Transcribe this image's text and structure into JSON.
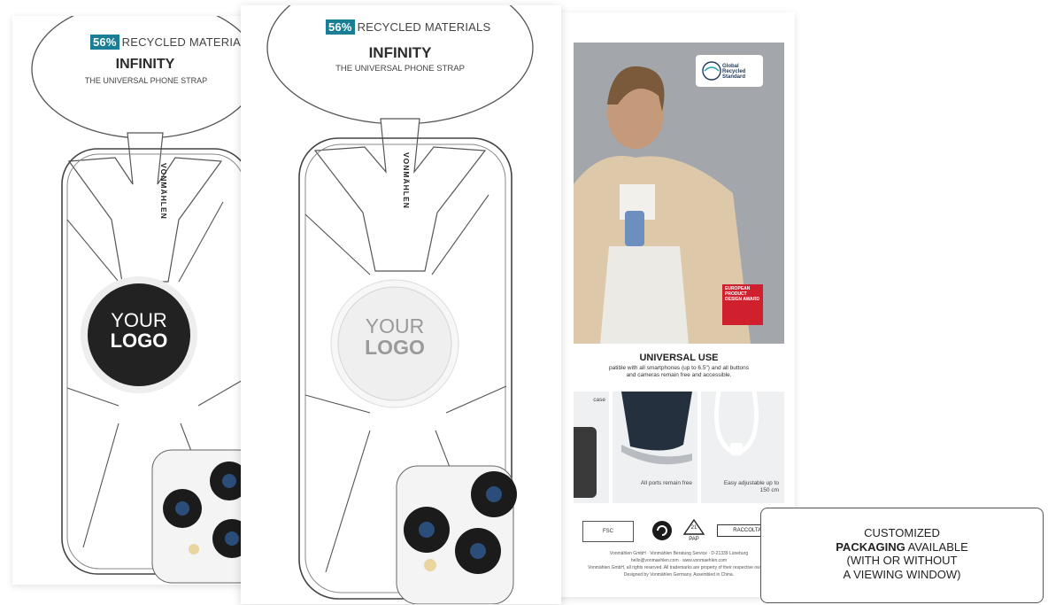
{
  "card_left": {
    "percent": "56%",
    "badge_text": "RECYCLED MATERIALS",
    "product_name": "INFINITY",
    "subtitle": "THE UNIVERSAL PHONE STRAP",
    "brand": "VONMÄHLEN",
    "logo_line1": "YOUR",
    "logo_line2": "LOGO"
  },
  "card_center": {
    "percent": "56%",
    "badge_text": "RECYCLED MATERIALS",
    "product_name": "INFINITY",
    "subtitle": "THE UNIVERSAL PHONE STRAP",
    "brand": "VONMÄHLEN",
    "logo_line1": "YOUR",
    "logo_line2": "LOGO"
  },
  "card_back": {
    "grs_label": "Global Recycled Standard",
    "award_label": "EUROPEAN PRODUCT DESIGN AWARD",
    "section_title": "UNIVERSAL USE",
    "section_text_1": "patible with all smartphones (up to 6.5\") and all buttons",
    "section_text_2": "and cameras remain free and accessible.",
    "thumb1_caption": "case",
    "thumb2_caption": "All ports remain free",
    "thumb3_caption": "Easy adjustable up to 150 cm",
    "fsc_label": "FSC",
    "recycle_code": "21",
    "recycle_label": "PAP",
    "raccolta_label": "RACCOLTA CA",
    "footer_line_1": "Vonmählen GmbH · Vonmählen Beratung Service · D-21339 Lüneburg",
    "footer_line_2": "hello@vonmaehlen.com · www.vonmaehlen.com",
    "footer_line_3": "Vonmählen GmbH, all rights reserved. All trademarks are property of their respective owners.",
    "footer_line_4": "Designed by Vonmählen Germany. Assembled in China."
  },
  "callout": {
    "line1": "CUSTOMIZED",
    "line2_bold": "PACKAGING",
    "line2_rest": " AVAILABLE",
    "line3": "(WITH OR WITHOUT",
    "line4": "A VIEWING WINDOW)"
  },
  "colors": {
    "accent_teal": "#1a7e96",
    "logo_dark": "#222222",
    "logo_light": "#f2f2f2",
    "award_red": "#d0202e"
  }
}
